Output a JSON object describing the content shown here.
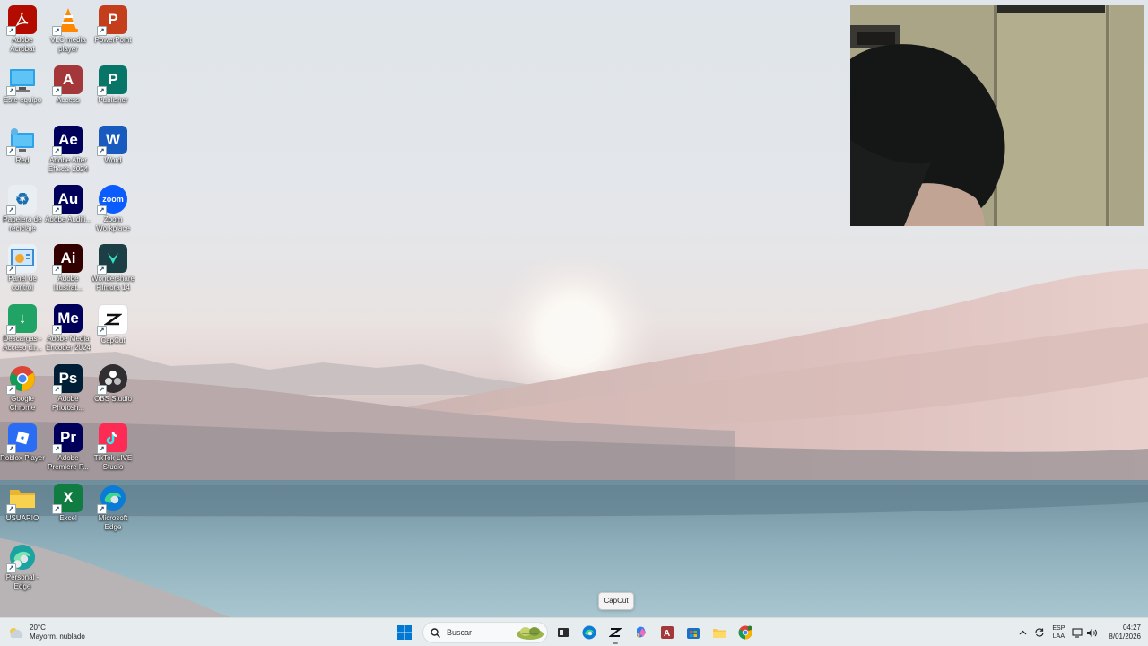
{
  "desktop": {
    "icons": [
      {
        "label": "Adobe Acrobat",
        "text": "",
        "color": "#b30b00"
      },
      {
        "label": "VLC media player",
        "text": "",
        "color": "#f08a00"
      },
      {
        "label": "PowerPoint",
        "text": "P",
        "color": "#c43e1c"
      },
      {
        "label": "Este equipo",
        "text": "",
        "color": "#1b9de2"
      },
      {
        "label": "Access",
        "text": "A",
        "color": "#a4373a"
      },
      {
        "label": "Publisher",
        "text": "P",
        "color": "#077568"
      },
      {
        "label": "Red",
        "text": "",
        "color": "#1b9de2"
      },
      {
        "label": "Adobe After Effects 2024",
        "text": "Ae",
        "color": "#00005b"
      },
      {
        "label": "Word",
        "text": "W",
        "color": "#185abd"
      },
      {
        "label": "Papelera de reciclaje",
        "text": "♻",
        "color": "#e9eef2"
      },
      {
        "label": "Adobe Auditi...",
        "text": "Au",
        "color": "#00005b"
      },
      {
        "label": "Zoom Workplace",
        "text": "zoom",
        "color": "#0b5cff"
      },
      {
        "label": "Panel de control",
        "text": "",
        "color": "#3c8dd6"
      },
      {
        "label": "Adobe Illustrat...",
        "text": "Ai",
        "color": "#330000"
      },
      {
        "label": "Wondershare Filmora 14",
        "text": "",
        "color": "#1c3f46"
      },
      {
        "label": "Descargas - Acceso dir...",
        "text": "↓",
        "color": "#21a366"
      },
      {
        "label": "Adobe Media Encoder 2024",
        "text": "Me",
        "color": "#00005b"
      },
      {
        "label": "CapCut",
        "text": "",
        "color": "#ffffff"
      },
      {
        "label": "Google Chrome",
        "text": "",
        "color": "#ffffff"
      },
      {
        "label": "Adobe Photosh...",
        "text": "Ps",
        "color": "#001e36"
      },
      {
        "label": "OBS Studio",
        "text": "",
        "color": "#302e31"
      },
      {
        "label": "Roblox Player",
        "text": "",
        "color": "#2a6df4"
      },
      {
        "label": "Adobe Premiere P...",
        "text": "Pr",
        "color": "#00005b"
      },
      {
        "label": "TikTok LIVE Studio",
        "text": "",
        "color": "#fe2c55"
      },
      {
        "label": "USUARIO",
        "text": "",
        "color": "#f7c948"
      },
      {
        "label": "Excel",
        "text": "X",
        "color": "#107c41"
      },
      {
        "label": "Microsoft Edge",
        "text": "",
        "color": "#0c7bd6"
      },
      {
        "label": "Personal - Edge",
        "text": "",
        "color": "#2bb39a"
      }
    ]
  },
  "tooltip": {
    "text": "CapCut"
  },
  "taskbar": {
    "weather": {
      "temp": "20°C",
      "condition": "Mayorm. nublado"
    },
    "search": {
      "placeholder": "Buscar"
    },
    "apps": [
      {
        "name": "start",
        "icon": "windows-icon"
      },
      {
        "name": "task-view",
        "icon": "task-view-icon"
      },
      {
        "name": "edge",
        "icon": "edge-icon"
      },
      {
        "name": "capcut",
        "icon": "capcut-icon"
      },
      {
        "name": "copilot",
        "icon": "copilot-icon"
      },
      {
        "name": "access",
        "icon": "access-icon"
      },
      {
        "name": "store",
        "icon": "store-icon"
      },
      {
        "name": "file-explorer",
        "icon": "folder-icon"
      },
      {
        "name": "chrome",
        "icon": "chrome-icon"
      }
    ],
    "tray": {
      "lang_top": "ESP",
      "lang_bottom": "LAA",
      "time": "04:27",
      "date": "8/01/2026"
    }
  }
}
